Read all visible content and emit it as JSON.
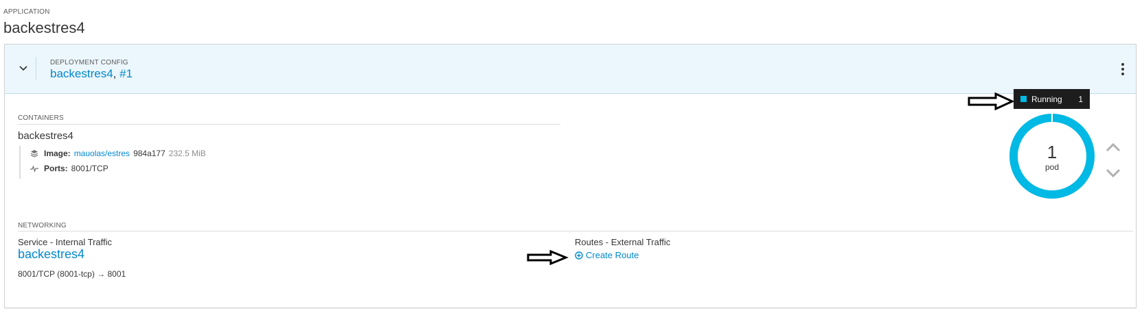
{
  "application": {
    "label": "APPLICATION",
    "name": "backestres4"
  },
  "deployment": {
    "label": "DEPLOYMENT CONFIG",
    "name": "backestres4",
    "separator": ",",
    "revision": "#1"
  },
  "containers": {
    "label": "CONTAINERS",
    "name": "backestres4",
    "image_label": "Image:",
    "image_link": "mauolas/estres",
    "image_hash": "984a177",
    "image_size": "232.5 MiB",
    "ports_label": "Ports:",
    "ports_value": "8001/TCP"
  },
  "networking": {
    "label": "NETWORKING",
    "service_label": "Service - Internal Traffic",
    "service_name": "backestres4",
    "service_ports": "8001/TCP (8001-tcp) → 8001",
    "routes_label": "Routes - External Traffic",
    "create_route": "Create Route"
  },
  "pods": {
    "tooltip_status": "Running",
    "tooltip_count": "1",
    "count": "1",
    "unit": "pod",
    "running_fraction": 1.0
  },
  "colors": {
    "accent": "#0088ce",
    "running": "#00b9e4",
    "header_bg": "#ecf7fd"
  },
  "icons": {
    "collapse": "chevron-down-icon",
    "menu": "kebab-menu-icon",
    "image": "layers-icon",
    "ports": "pulse-icon",
    "create_route": "plus-circle-icon",
    "scale_up": "chevron-up-icon",
    "scale_down": "chevron-down-icon",
    "annotation": "arrow-right-icon"
  }
}
